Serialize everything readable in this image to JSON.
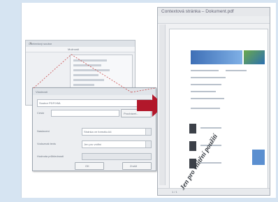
{
  "left_dialog": {
    "bg_window_title": "Contextový soubor",
    "bg_menu_label": "Možnosti",
    "dialog_title": "Vlastnosti",
    "text_field_value": "Soubor PDF/XML",
    "label_file": "Cesta",
    "browse_button": "Procházet...",
    "row1_label": "Nastavení",
    "row1_value": "Stránka ve formátu A4",
    "row2_label": "Vodoznak textu",
    "row2_value": "Jen pro vnitřní",
    "row3_label": "Hodnota průhlednosti",
    "ok_button": "OK",
    "cancel_button": "Zrušit"
  },
  "doc_window": {
    "title": "Contextová stránka – Dokument.pdf",
    "watermark_text": "Jen pro vnitřní použití",
    "status_pages": "1 / 1"
  },
  "colors": {
    "arrow": "#b2182b",
    "accent": "#3e6fb6"
  },
  "icons": [
    "right-arrow-icon"
  ]
}
